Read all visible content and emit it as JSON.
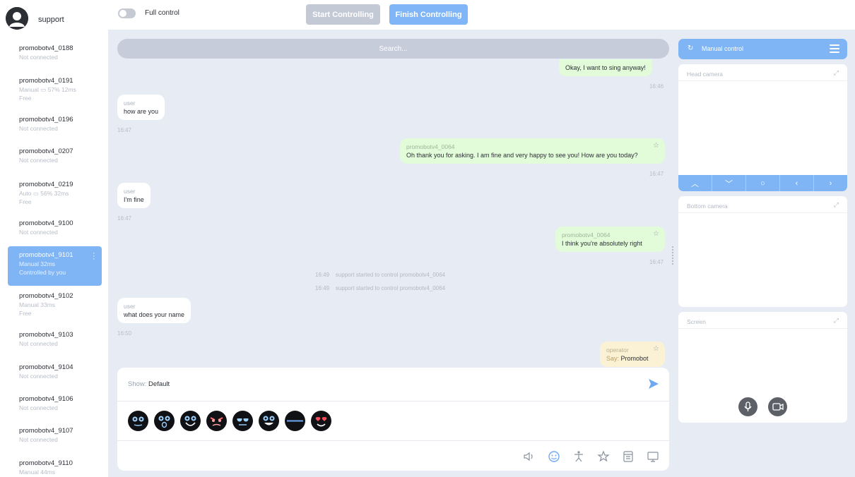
{
  "header": {
    "user_name": "support",
    "full_control_label": "Full control",
    "start_label": "Start Controlling",
    "finish_label": "Finish Controlling"
  },
  "robots": [
    {
      "name": "promobotv4_0188",
      "line1": "Not connected",
      "line2": ""
    },
    {
      "name": "promobotv4_0191",
      "line1": "Manual  ▭ 57%  12ms",
      "line2": "Free"
    },
    {
      "name": "promobotv4_0196",
      "line1": "Not connected",
      "line2": ""
    },
    {
      "name": "promobotv4_0207",
      "line1": "Not connected",
      "line2": ""
    },
    {
      "name": "promobotv4_0219",
      "line1": "Auto  ▭ 56%  32ms",
      "line2": "Free"
    },
    {
      "name": "promobotv4_9100",
      "line1": "Not connected",
      "line2": ""
    },
    {
      "name": "promobotv4_9101",
      "line1": "Manual    32ms",
      "line2": "Controlled by you"
    },
    {
      "name": "promobotv4_9102",
      "line1": "Manual    33ms",
      "line2": "Free"
    },
    {
      "name": "promobotv4_9103",
      "line1": "Not connected",
      "line2": ""
    },
    {
      "name": "promobotv4_9104",
      "line1": "Not connected",
      "line2": ""
    },
    {
      "name": "promobotv4_9106",
      "line1": "Not connected",
      "line2": ""
    },
    {
      "name": "promobotv4_9107",
      "line1": "Not connected",
      "line2": ""
    },
    {
      "name": "promobotv4_9110",
      "line1": "Manual    44ms",
      "line2": ""
    }
  ],
  "search": {
    "placeholder": "Search..."
  },
  "chat": {
    "m1": {
      "text": "Okay, I want to sing anyway!",
      "time": "16:46"
    },
    "m2": {
      "sender": "user",
      "text": "how are you",
      "time": "16:47"
    },
    "m3": {
      "sender": "promobotv4_0064",
      "text": "Oh thank you for asking. I am fine and very happy to see you! How are you today?",
      "time": "16:47"
    },
    "m4": {
      "sender": "user",
      "text": "I'm fine",
      "time": "16:47"
    },
    "m5": {
      "sender": "promobotv4_0064",
      "text": "I think you're absolutely right",
      "time": "16:47"
    },
    "sys1": {
      "time": "16:49",
      "text": "support started to control promobotv4_0064"
    },
    "sys2": {
      "time": "16:49",
      "text": "support started to control promobotv4_0064"
    },
    "m6": {
      "sender": "user",
      "text": "what does your name",
      "time": "16:50"
    },
    "m7": {
      "sender": "operator",
      "prefix": "Say:",
      "text": "Promobot"
    }
  },
  "compose": {
    "show_label": "Show:",
    "show_value": "Default"
  },
  "right": {
    "manual_label": "Manual control",
    "head_camera": "Head camera",
    "bottom_camera": "Bottom camera",
    "screen": "Screen"
  },
  "colors": {
    "accent": "#7fb4f5",
    "robot_bubble": "#e2fbd8",
    "operator_bubble": "#fbf2d6",
    "background": "#e6ebf4"
  }
}
